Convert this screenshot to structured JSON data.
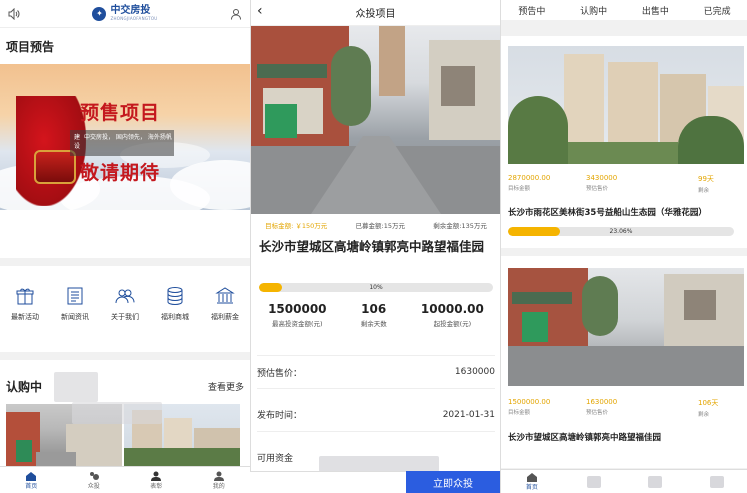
{
  "home": {
    "logo_text": "中交房投",
    "logo_sub": "ZHONGJIAOFANGTOU",
    "section_title": "项目预告",
    "banner": {
      "line1": "预售项目",
      "line2": "敬请期待",
      "tag_lines": [
        "建",
        "设",
        "中交房投， 国内领先， 海外扬帆"
      ]
    },
    "icons": [
      {
        "label": "最新活动",
        "icon": "gift-icon"
      },
      {
        "label": "新闻资讯",
        "icon": "news-icon"
      },
      {
        "label": "关于我们",
        "icon": "users-icon"
      },
      {
        "label": "福利商城",
        "icon": "coins-icon"
      },
      {
        "label": "福利薪金",
        "icon": "bank-icon"
      }
    ],
    "subscribe_title": "认购中",
    "see_more": "查看更多",
    "tabs": [
      {
        "label": "首页",
        "icon": "home-icon"
      },
      {
        "label": "众投",
        "icon": "invest-icon"
      },
      {
        "label": "表彰",
        "icon": "person-icon"
      },
      {
        "label": "我的",
        "icon": "profile-icon"
      }
    ]
  },
  "detail": {
    "header_title": "众投项目",
    "target_amount": "目标金额: ￥150万元",
    "raised_amount": "已募金额:15万元",
    "remaining_amount": "剩余金额:135万元",
    "project_title": "长沙市望城区高塘岭镇郭亮中路望福佳园",
    "progress_label": "10%",
    "progress": 0.1,
    "stats": [
      {
        "value": "1500000",
        "label": "最高投资金额(元)"
      },
      {
        "value": "106",
        "label": "剩余天数"
      },
      {
        "value": "10000.00",
        "label": "起投金额(元)"
      }
    ],
    "rows": [
      {
        "label": "预估售价：",
        "value": "1630000"
      },
      {
        "label": "发布时间：",
        "value": "2021-01-31"
      },
      {
        "label": "可用资金",
        "value": ""
      }
    ],
    "buy_button": "立即众投"
  },
  "list": {
    "tabs": [
      "预告中",
      "认购中",
      "出售中",
      "已完成"
    ],
    "cards": [
      {
        "target": "2870000.00",
        "target_label": "目标金额",
        "price": "3430000",
        "price_label": "预估售价",
        "days": "99天",
        "days_label": "剩余",
        "title": "长沙市雨花区美林街35号益船山生态园（华雅花园）",
        "progress": 0.2306,
        "progress_label": "23.06%"
      },
      {
        "target": "1500000.00",
        "target_label": "目标金额",
        "price": "1630000",
        "price_label": "预估售价",
        "days": "106天",
        "days_label": "剩余",
        "title": "长沙市望城区高塘岭镇郭亮中路望福佳园"
      }
    ],
    "tabs_bottom": [
      {
        "label": "首页",
        "icon": "home-icon"
      }
    ]
  }
}
